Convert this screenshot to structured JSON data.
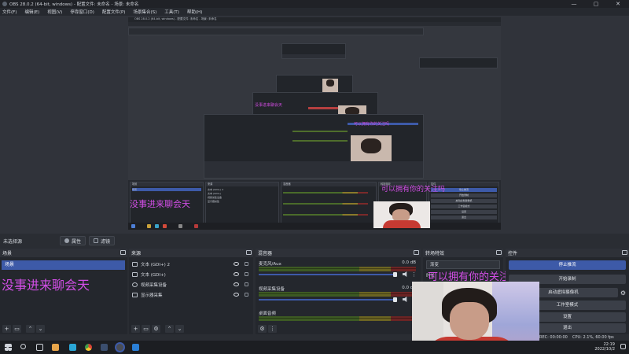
{
  "window": {
    "title": "OBS 28.0.2 (64-bit, windows) - 配置文件: 未命名 - 场景: 未命名",
    "controls": [
      "—",
      "▢",
      "✕"
    ]
  },
  "menu": [
    "文件(F)",
    "编辑(E)",
    "视图(V)",
    "停靠窗口(D)",
    "配置文件(P)",
    "场景集合(S)",
    "工具(T)",
    "帮助(H)"
  ],
  "overlay_text": {
    "left": "没事进来聊会天",
    "right": "可以拥有你的关注吗"
  },
  "status_row": {
    "label": "未选择源",
    "properties_label": "属性",
    "filters_label": "滤镜"
  },
  "scenes": {
    "title": "场景",
    "items": [
      "场景"
    ]
  },
  "sources": {
    "title": "来源",
    "items": [
      {
        "name": "文本 (GDI+) 2",
        "icon": "text-icon"
      },
      {
        "name": "文本 (GDI+)",
        "icon": "text-icon"
      },
      {
        "name": "视频采集设备",
        "icon": "camera-icon"
      },
      {
        "name": "显示器采集",
        "icon": "monitor-icon"
      }
    ]
  },
  "mixer": {
    "title": "混音器",
    "channels": [
      {
        "name": "麦克风/Aux",
        "db": "0.0 dB"
      },
      {
        "name": "视频采集设备",
        "db": "0.0 dB"
      },
      {
        "name": "桌面音频",
        "db": ""
      }
    ]
  },
  "transitions": {
    "title": "转场特效",
    "selected": "渐变",
    "duration_label": "时长"
  },
  "controls": {
    "title": "控件",
    "buttons": [
      "停止推流",
      "开始录制",
      "启动虚拟摄像机",
      "工作室模式",
      "设置",
      "退出"
    ]
  },
  "statusbar": {
    "rec": "REC: 00:00:00",
    "cpu": "CPU: 2.1%, 60.00 fps"
  },
  "clock": {
    "time": "22:19",
    "date": "2022/10/2"
  },
  "preview_labels": {
    "scenes": "场景",
    "sources": "来源",
    "mixer": "混音器",
    "transitions": "转场特效",
    "controls": "控件"
  },
  "colors": {
    "accent": "#3d5aa8",
    "overlay_magenta": "#d24ee6",
    "background": "#2a2d33"
  }
}
